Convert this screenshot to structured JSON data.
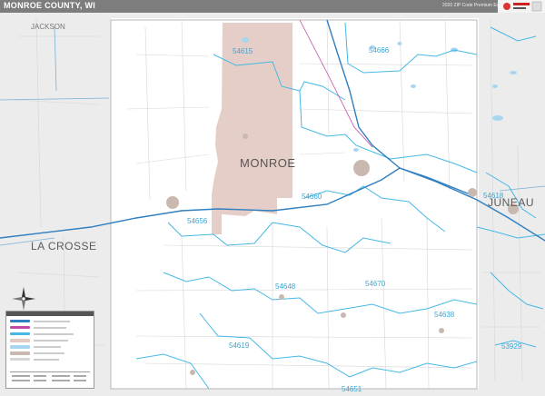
{
  "header": {
    "title": "MONROE COUNTY, WI",
    "edition": "2020 ZIP Code Premium Edition",
    "brand_color": "#7d7d7d"
  },
  "map": {
    "county_name": "MONROE",
    "neighbor_counties": {
      "jackson": "JACKSON",
      "la_crosse": "LA CROSSE",
      "juneau": "JUNEAU"
    },
    "zip_labels": {
      "z54615": "54615",
      "z54666": "54666",
      "z54660": "54660",
      "z54618": "54618",
      "z54656": "54656",
      "z54648": "54648",
      "z54670": "54670",
      "z54638": "54638",
      "z54619": "54619",
      "z53929": "53929",
      "z54651": "54651"
    },
    "colors": {
      "zip_boundary": "#45b8e6",
      "highway": "#2f7fc1",
      "military_area": "#e2c9c2",
      "neighbor_fill": "#ececec",
      "road": "#d8d8d8"
    }
  },
  "icons": {
    "compass": "compass-rose-icon",
    "logo": "publisher-logo-icon"
  }
}
